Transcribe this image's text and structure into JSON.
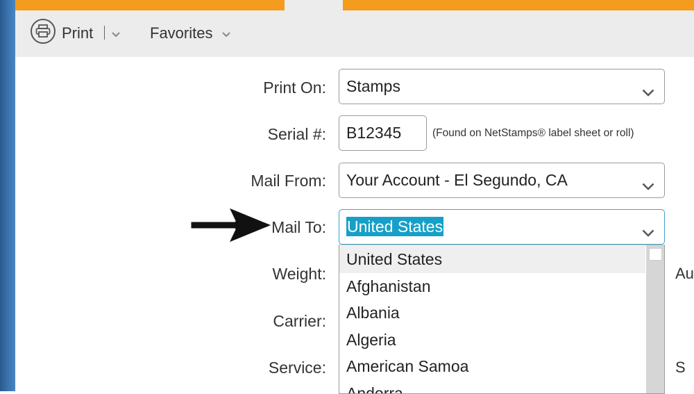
{
  "toolbar": {
    "print_label": "Print",
    "favorites_label": "Favorites"
  },
  "form": {
    "print_on": {
      "label": "Print On:",
      "value": "Stamps"
    },
    "serial": {
      "label": "Serial #:",
      "value": "B12345",
      "hint": "(Found on NetStamps® label sheet or roll)"
    },
    "mail_from": {
      "label": "Mail From:",
      "value": "Your Account - El Segundo, CA"
    },
    "mail_to": {
      "label": "Mail To:",
      "value": "United States"
    },
    "weight": {
      "label": "Weight:"
    },
    "carrier": {
      "label": "Carrier:"
    },
    "service": {
      "label": "Service:"
    }
  },
  "mail_to_options": [
    "United States",
    "Afghanistan",
    "Albania",
    "Algeria",
    "American Samoa",
    "Andorra"
  ],
  "right_cutoff": {
    "weight_side": "Au",
    "service_side": "S"
  },
  "colors": {
    "accent_orange": "#f39c1e",
    "selection_blue": "#16a0c8",
    "focus_border": "#3ba3c8"
  }
}
